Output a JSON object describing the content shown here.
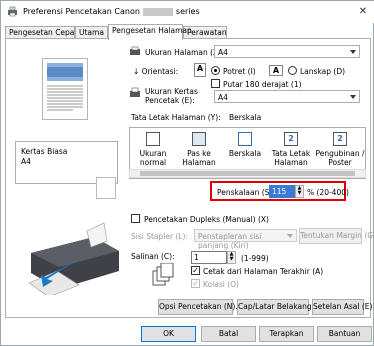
{
  "window": {
    "title_prefix": "Preferensi Pencetakan Canon",
    "title_suffix": "series",
    "close_glyph": "✕"
  },
  "tabs": [
    {
      "label": "Pengesetan Cepat",
      "active": false
    },
    {
      "label": "Utama",
      "active": false
    },
    {
      "label": "Pengesetan Halaman",
      "active": true
    },
    {
      "label": "Perawatan",
      "active": false
    }
  ],
  "left": {
    "media_type": "Kertas Biasa",
    "paper_size": "A4"
  },
  "page_setup": {
    "page_size_label": "Ukuran Halaman (Z):",
    "page_size_value": "A4",
    "orientation_label": "Orientasi:",
    "portrait_label": "Potret (I)",
    "landscape_label": "Lanskap (D)",
    "orientation_selected": "portrait",
    "rotate_label": "Putar 180 derajat (1)",
    "rotate_checked": false,
    "output_size_label": "Ukuran Kertas Pencetak (E):",
    "output_size_value": "A4"
  },
  "layout": {
    "label": "Tata Letak Halaman (Y):",
    "current_value": "Berskala",
    "items": [
      {
        "label": "Ukuran normal",
        "icon": "page-normal-icon"
      },
      {
        "label": "Pas ke Halaman",
        "icon": "fit-to-page-icon"
      },
      {
        "label": "Berskala",
        "icon": "scaled-icon"
      },
      {
        "label": "Tata Letak Halaman",
        "icon": "page-layout-icon"
      },
      {
        "label": "Pengubinan / Poster",
        "icon": "tiling-poster-icon"
      }
    ],
    "selected_index": 2
  },
  "scaling": {
    "label": "Penskalaan (S):",
    "value": "115",
    "range": "% (20-400)"
  },
  "duplex": {
    "label": "Pencetakan Dupleks (Manual) (X)",
    "checked": false,
    "staple_label": "Sisi Stapler (L):",
    "staple_value": "Penstapleran sisi panjang (Kiri)",
    "margin_button": "Tentukan Margin (G)..."
  },
  "copies": {
    "label": "Salinan (C):",
    "value": "1",
    "range": "(1-999)",
    "reverse_label": "Cetak dari Halaman Terakhir (A)",
    "reverse_checked": true,
    "collate_label": "Kolasi (O)",
    "collate_checked": true
  },
  "bottom_buttons": {
    "print_options": "Opsi Pencetakan (N)...",
    "stamp_background": "Cap/Latar Belakang (B)...",
    "defaults": "Setelan Asal (E)"
  },
  "dialog_buttons": {
    "ok": "OK",
    "cancel": "Batal",
    "apply": "Terapkan",
    "help": "Bantuan"
  },
  "colors": {
    "highlight": "#e00000",
    "accent": "#0078d7"
  }
}
